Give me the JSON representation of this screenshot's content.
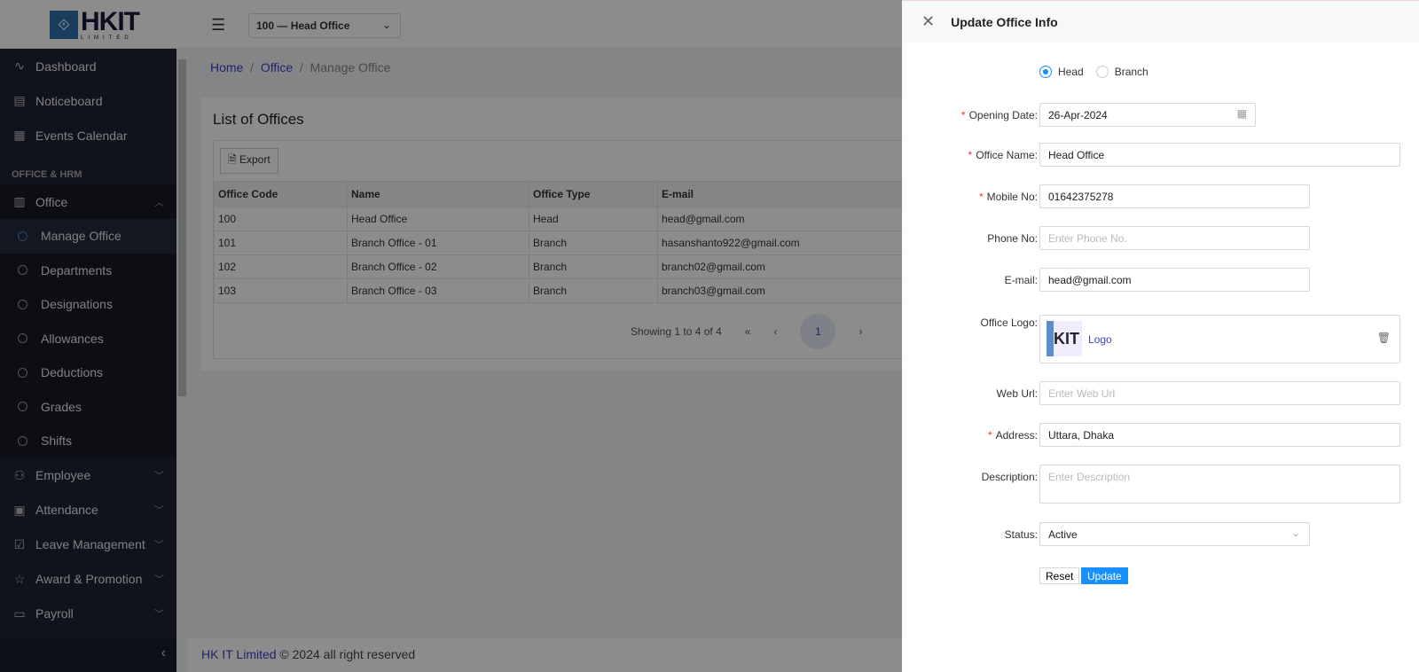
{
  "header": {
    "logo_text": "HKIT",
    "logo_sub": "LIMITED",
    "office_select": "100 — Head Office"
  },
  "sidebar": {
    "top_items": [
      {
        "label": "Dashboard",
        "icon": "chart-line-icon"
      },
      {
        "label": "Noticeboard",
        "icon": "notice-icon"
      },
      {
        "label": "Events Calendar",
        "icon": "calendar-icon"
      }
    ],
    "section": "OFFICE & HRM",
    "office": {
      "label": "Office",
      "icon": "building-icon"
    },
    "office_sub": [
      "Manage Office",
      "Departments",
      "Designations",
      "Allowances",
      "Deductions",
      "Grades",
      "Shifts"
    ],
    "more_items": [
      {
        "label": "Employee",
        "icon": "people-icon"
      },
      {
        "label": "Attendance",
        "icon": "contact-book-icon"
      },
      {
        "label": "Leave Management",
        "icon": "calendar-check-icon"
      },
      {
        "label": "Award & Promotion",
        "icon": "star-icon"
      },
      {
        "label": "Payroll",
        "icon": "money-icon"
      }
    ]
  },
  "breadcrumb": {
    "home": "Home",
    "office": "Office",
    "current": "Manage Office"
  },
  "list": {
    "title": "List of Offices",
    "export": "Export",
    "columns": [
      "Office Code",
      "Name",
      "Office Type",
      "E-mail"
    ],
    "rows": [
      [
        "100",
        "Head Office",
        "Head",
        "head@gmail.com"
      ],
      [
        "101",
        "Branch Office - 01",
        "Branch",
        "hasanshanto922@gmail.com"
      ],
      [
        "102",
        "Branch Office - 02",
        "Branch",
        "branch02@gmail.com"
      ],
      [
        "103",
        "Branch Office - 03",
        "Branch",
        "branch03@gmail.com"
      ]
    ],
    "showing": "Showing 1 to 4 of 4",
    "page": "1"
  },
  "footer": {
    "brand": "HK IT Limited",
    "text": " © 2024 all right reserved"
  },
  "drawer": {
    "title": "Update Office Info",
    "radio_head": "Head",
    "radio_branch": "Branch",
    "selected_type": "Head",
    "labels": {
      "opening_date": "Opening Date",
      "office_name": "Office Name",
      "mobile": "Mobile No",
      "phone": "Phone No",
      "email": "E-mail",
      "logo": "Office Logo",
      "web": "Web Url",
      "address": "Address",
      "description": "Description",
      "status": "Status"
    },
    "values": {
      "opening_date": "26-Apr-2024",
      "office_name": "Head Office",
      "mobile": "01642375278",
      "email": "head@gmail.com",
      "address": "Uttara, Dhaka",
      "status": "Active"
    },
    "placeholders": {
      "phone": "Enter Phone No.",
      "web": "Enter Web Url",
      "description": "Enter Description"
    },
    "logo_link": "Logo",
    "reset": "Reset",
    "update": "Update"
  },
  "colors": {
    "accent": "#1890ff",
    "link": "#3f3fbf",
    "required": "#ee3333"
  }
}
